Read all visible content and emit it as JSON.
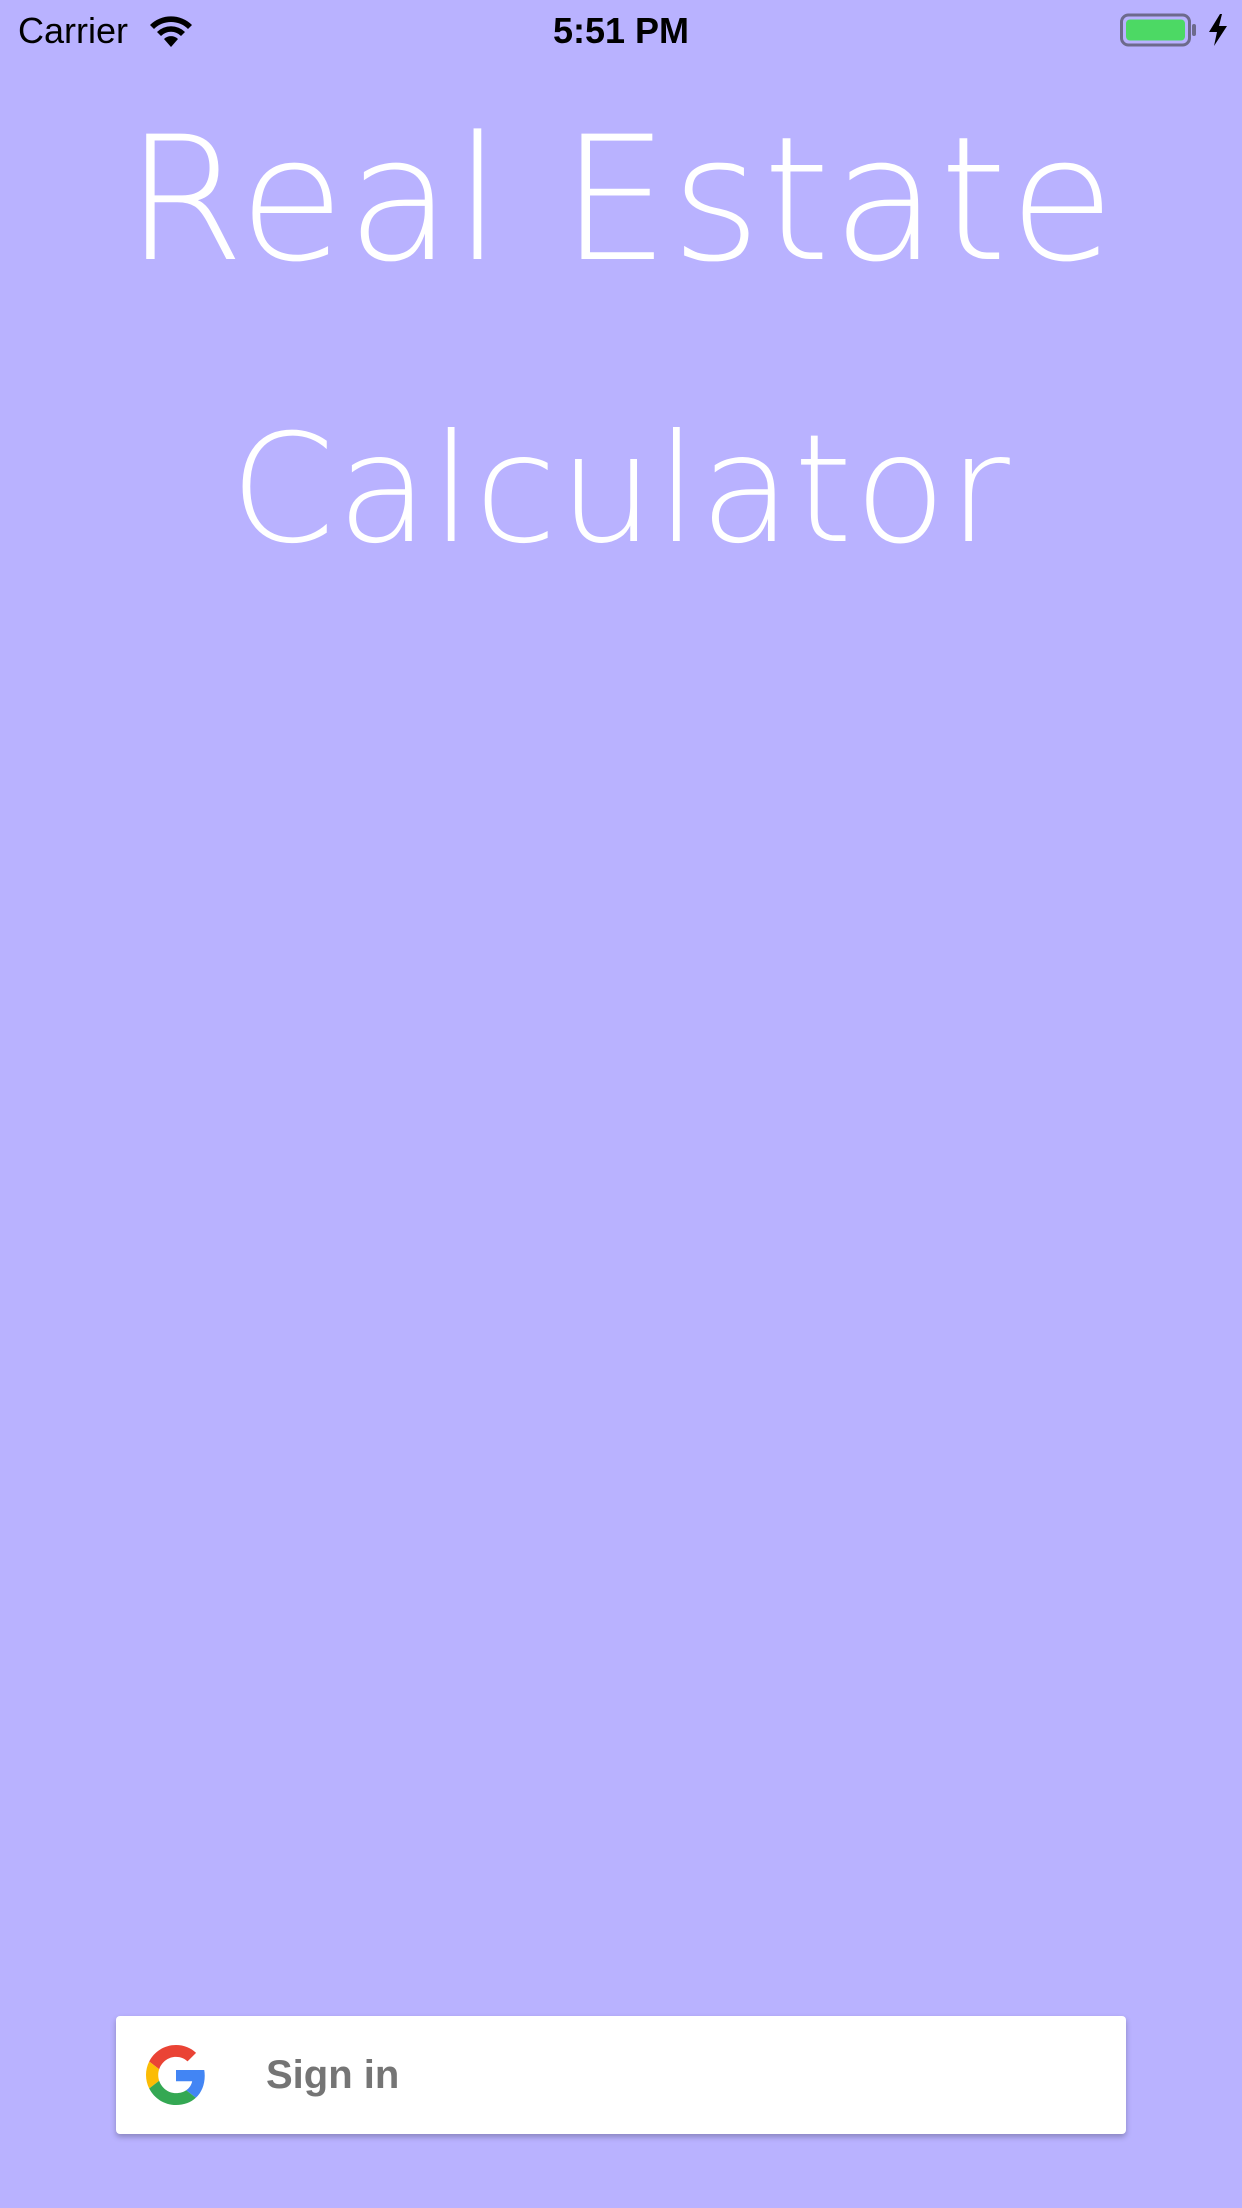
{
  "status_bar": {
    "carrier": "Carrier",
    "time": "5:51 PM",
    "icons": [
      "wifi-icon",
      "battery-icon",
      "charging-icon"
    ],
    "battery_color": "#4cd964"
  },
  "title": {
    "line1": "Real Estate",
    "line2": "Calculator"
  },
  "signin": {
    "label": "Sign in",
    "icon": "google-icon"
  },
  "colors": {
    "background": "#b9b2ff",
    "title_text": "#ffffff",
    "button_bg": "#ffffff",
    "button_text": "#757575"
  }
}
